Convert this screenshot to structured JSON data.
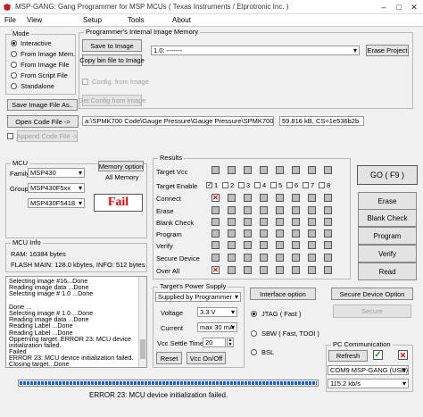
{
  "window": {
    "title": "MSP-GANG:  Gang Programmer for MSP MCUs  ( Texas Instruments / Elprotronic Inc. )"
  },
  "menu": [
    "File",
    "View",
    "Setup",
    "Tools",
    "About"
  ],
  "mode": {
    "title": "Mode",
    "options": [
      "Interactive",
      "From Image Mem.",
      "From Image File",
      "From Script File",
      "Standalone"
    ],
    "selected": 0,
    "save_image_btn": "Save Image File As.."
  },
  "image_memory": {
    "title": "Programmer's Internal Image Memory",
    "save_to_image_btn": "Save to Image",
    "copy_bin_btn": "Copy bin file to Image",
    "slot_value": "1.0: -------",
    "erase_project_btn": "Erase Project",
    "config_from_image_label": "Config. from Image",
    "get_config_btn": "Get Config from Image"
  },
  "code_file": {
    "open_btn": "Open Code File ->",
    "path": "a:\\SPMK700 Code\\Gauge Pressure\\Gauge Pressure\\SPMK700.txt",
    "info": "59.816 kB, CS=1e536b2b",
    "append_btn": "Append Code File ->"
  },
  "mcu": {
    "title": "MCU",
    "family_label": "Family:",
    "family_value": "MSP430",
    "group_label": "Group:",
    "group_value": "MSP430F5xx",
    "device_value": "MSP430F5418",
    "memory_option_btn": "Memory option",
    "memory_option_value": "All Memory",
    "result": "Fail"
  },
  "mcu_info": {
    "title": "MCU Info",
    "ram": "RAM: 16384 bytes",
    "flash": "FLASH MAIN: 128.0 kbytes,  INFO: 512 bytes"
  },
  "log": [
    "Selecting image #16...Done",
    "Reading image data ...Done",
    "Selecting image # 1.0 ...Done",
    "",
    "Done ...",
    "Selecting image # 1.0 ...Done",
    "Reading image data ...Done",
    "Reading Label ...Done",
    "Reading Label ...Done",
    "Opperning target..ERROR 23: MCU device",
    "initialization failed.",
    "Failed",
    "ERROR 23: MCU device initialization failed.",
    "Closing target...Done"
  ],
  "results": {
    "title": "Results",
    "target_vcc_label": "Target Vcc",
    "target_enable_label": "Target Enable",
    "target_numbers": [
      "1",
      "2",
      "3",
      "4",
      "5",
      "6",
      "7",
      "8"
    ],
    "target_enabled": [
      true,
      false,
      false,
      false,
      false,
      false,
      false,
      false
    ],
    "rows": [
      {
        "label": "Connect",
        "marks": [
          "x",
          "",
          "",
          "",
          "",
          "",
          "",
          ""
        ]
      },
      {
        "label": "Erase",
        "marks": [
          "",
          "",
          "",
          "",
          "",
          "",
          "",
          ""
        ]
      },
      {
        "label": "Blank Check",
        "marks": [
          "",
          "",
          "",
          "",
          "",
          "",
          "",
          ""
        ]
      },
      {
        "label": "Program",
        "marks": [
          "",
          "",
          "",
          "",
          "",
          "",
          "",
          ""
        ]
      },
      {
        "label": "Verify",
        "marks": [
          "",
          "",
          "",
          "",
          "",
          "",
          "",
          ""
        ]
      },
      {
        "label": "Secure Device",
        "marks": [
          "",
          "",
          "",
          "",
          "",
          "",
          "",
          ""
        ]
      },
      {
        "label": "Over All",
        "marks": [
          "x",
          "",
          "",
          "",
          "",
          "",
          "",
          ""
        ]
      }
    ]
  },
  "actions": {
    "go": "GO   ( F9 )",
    "erase": "Erase",
    "blank_check": "Blank Check",
    "program": "Program",
    "verify": "Verify",
    "read": "Read"
  },
  "power_supply": {
    "title": "Target's Power Supply",
    "source_value": "Supplied by Programmer",
    "voltage_label": "Voltage",
    "voltage_value": "3.3 V",
    "current_label": "Current",
    "current_value": "max 30 mA",
    "settle_label": "Vcc Settle Time",
    "settle_value": "20",
    "reset_btn": "Reset",
    "vcc_btn": "Vcc On/Off"
  },
  "interface": {
    "btn": "Interface option",
    "options": [
      "JTAG ( Fast )",
      "SBW ( Fast, TDOI )",
      "BSL"
    ],
    "selected": 0
  },
  "secure": {
    "btn": "Secure Device Option",
    "secure_btn": "Secure"
  },
  "pc_comm": {
    "title": "PC Communication",
    "refresh_btn": "Refresh",
    "port_value": "COM9  MSP-GANG (USB)",
    "baud_value": "115.2 kb/s"
  },
  "status": {
    "progress": 1.0,
    "message": "ERROR 23: MCU device initialization failed."
  },
  "colors": {
    "fail_red": "#e00000",
    "progress_blue": "#1a5fd0",
    "check_green": "#1a9a1a"
  }
}
